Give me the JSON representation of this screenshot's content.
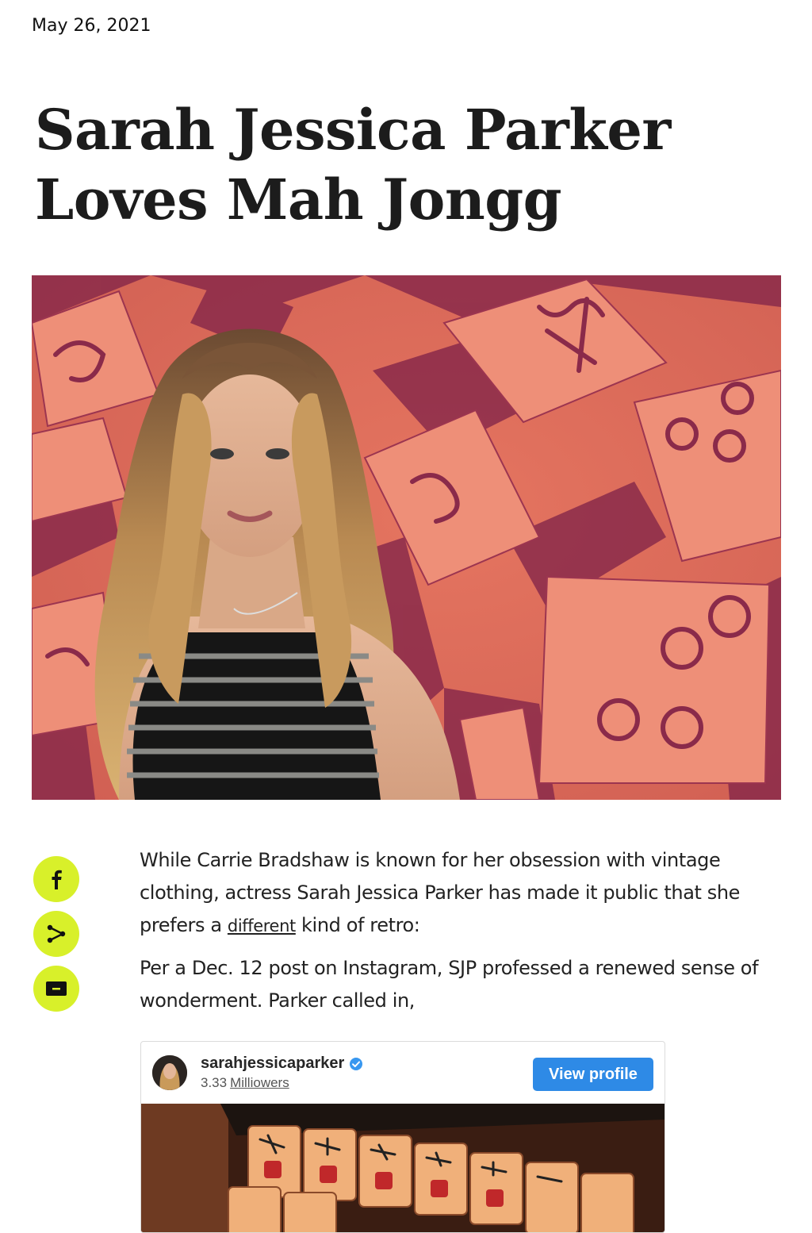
{
  "article": {
    "date": "May 26, 2021",
    "title": "Sarah Jessica Parker Loves Mah Jongg",
    "hero_alt": "Sarah Jessica Parker in front of mahjong tiles"
  },
  "share": {
    "items": [
      {
        "name": "facebook",
        "icon": "facebook-icon"
      },
      {
        "name": "share",
        "icon": "share-icon"
      },
      {
        "name": "email",
        "icon": "email-icon"
      }
    ]
  },
  "body": {
    "p1_before": "While Carrie Bradshaw is known for her obsession with vintage clothing, actress Sarah Jessica Parker has made it public that she prefers a ",
    "p1_link": "different",
    "p1_after": " kind of retro:",
    "p2": "Per a Dec. 12 post on Instagram, SJP professed a renewed sense of wonderment. Parker called in,"
  },
  "instagram": {
    "handle": "sarahjessicaparker",
    "followers_count": "3.33",
    "followers_label": "Milliowers",
    "view_profile_label": "View profile",
    "verified_icon": "verified-badge-icon"
  },
  "colors": {
    "accent_share": "#d8f02a",
    "ig_button": "#2e8ae6",
    "hero_bg": "#de6c57",
    "hero_shadow": "#8a2a4a"
  }
}
